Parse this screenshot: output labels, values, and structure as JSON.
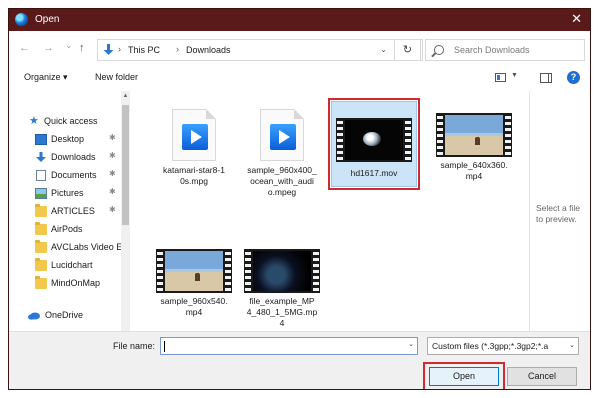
{
  "window": {
    "title": "Open",
    "close": "✕"
  },
  "nav": {
    "back": "←",
    "forward": "→",
    "dropdown": "⌄",
    "up": "↑",
    "breadcrumbs": [
      "This PC",
      "Downloads"
    ],
    "refresh": "↻",
    "search_placeholder": "Search Downloads"
  },
  "toolbar": {
    "organize": "Organize ▾",
    "new_folder": "New folder",
    "help": "?"
  },
  "sidebar": {
    "items": [
      {
        "label": "Quick access",
        "icon": "star-icon"
      },
      {
        "label": "Desktop",
        "icon": "desktop-icon",
        "pinned": true
      },
      {
        "label": "Downloads",
        "icon": "download-icon",
        "pinned": true
      },
      {
        "label": "Documents",
        "icon": "documents-icon",
        "pinned": true
      },
      {
        "label": "Pictures",
        "icon": "pictures-icon",
        "pinned": true
      },
      {
        "label": "ARTICLES",
        "icon": "folder-icon",
        "pinned": true
      },
      {
        "label": "AirPods",
        "icon": "folder-icon"
      },
      {
        "label": "AVCLabs Video E",
        "icon": "folder-icon"
      },
      {
        "label": "Lucidchart",
        "icon": "folder-icon"
      },
      {
        "label": "MindOnMap",
        "icon": "folder-icon"
      },
      {
        "label": "OneDrive",
        "icon": "cloud-icon"
      }
    ],
    "pin_glyph": "📌"
  },
  "files": [
    {
      "name": "katamari-star8-10s.mpg",
      "display": "katamari-star8-1\n0s.mpg",
      "type": "mpeg-doc"
    },
    {
      "name": "sample_960x400_ocean_with_audio.mpeg",
      "display": "sample_960x400_\nocean_with_audi\no.mpeg",
      "type": "mpeg-doc"
    },
    {
      "name": "hd1617.mov",
      "display": "hd1617.mov",
      "type": "video-disc",
      "selected": true
    },
    {
      "name": "sample_640x360.mp4",
      "display": "sample_640x360.\nmp4",
      "type": "video-beach"
    },
    {
      "name": "sample_960x540.mp4",
      "display": "sample_960x540.\nmp4",
      "type": "video-beach"
    },
    {
      "name": "file_example_MP4_480_1_5MG.mp4",
      "display": "file_example_MP\n4_480_1_5MG.mp\n4",
      "type": "video-space"
    }
  ],
  "preview": {
    "text": "Select a file to preview."
  },
  "footer": {
    "file_name_label": "File name:",
    "file_name_value": "",
    "file_type": "Custom files (*.3gpp;*.3gp2;*.a",
    "open_label": "Open",
    "cancel_label": "Cancel"
  },
  "colors": {
    "titlebar": "#5a1a1a",
    "highlight": "#d0292f",
    "selection": "#cce4f7"
  }
}
